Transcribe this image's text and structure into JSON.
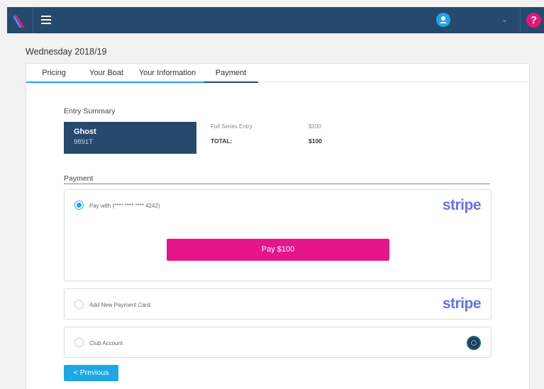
{
  "header": {
    "logo": "logo-icon",
    "menu_icon": "menu-icon",
    "user_icon": "user-icon",
    "dropdown_icon": "chevron-down-icon",
    "help_label": "?"
  },
  "page": {
    "title": "Wednesday 2018/19"
  },
  "tabs": [
    {
      "label": "Pricing"
    },
    {
      "label": "Your Boat"
    },
    {
      "label": "Your Information"
    },
    {
      "label": "Payment",
      "active": true
    }
  ],
  "entry_summary": {
    "label": "Entry Summary",
    "boat_name": "Ghost",
    "sail_number": "9891T",
    "line_item_label": "Full Series Entry",
    "line_item_amount": "$100",
    "total_label": "TOTAL:",
    "total_amount": "$100"
  },
  "payment": {
    "label": "Payment",
    "options": [
      {
        "label": "Pay with (**** **** **** 4242)",
        "selected": true,
        "brand": "stripe"
      },
      {
        "label": "Add New Payment Card",
        "selected": false,
        "brand": "stripe"
      },
      {
        "label": "Club Account",
        "selected": false,
        "brand": "club-icon"
      }
    ],
    "pay_button": "Pay $100"
  },
  "nav": {
    "previous": "< Previous"
  },
  "colors": {
    "header": "#254a6d",
    "accent": "#1ea7e6",
    "pay_button": "#e5158a",
    "stripe": "#6772e5",
    "help": "#e5157a"
  }
}
